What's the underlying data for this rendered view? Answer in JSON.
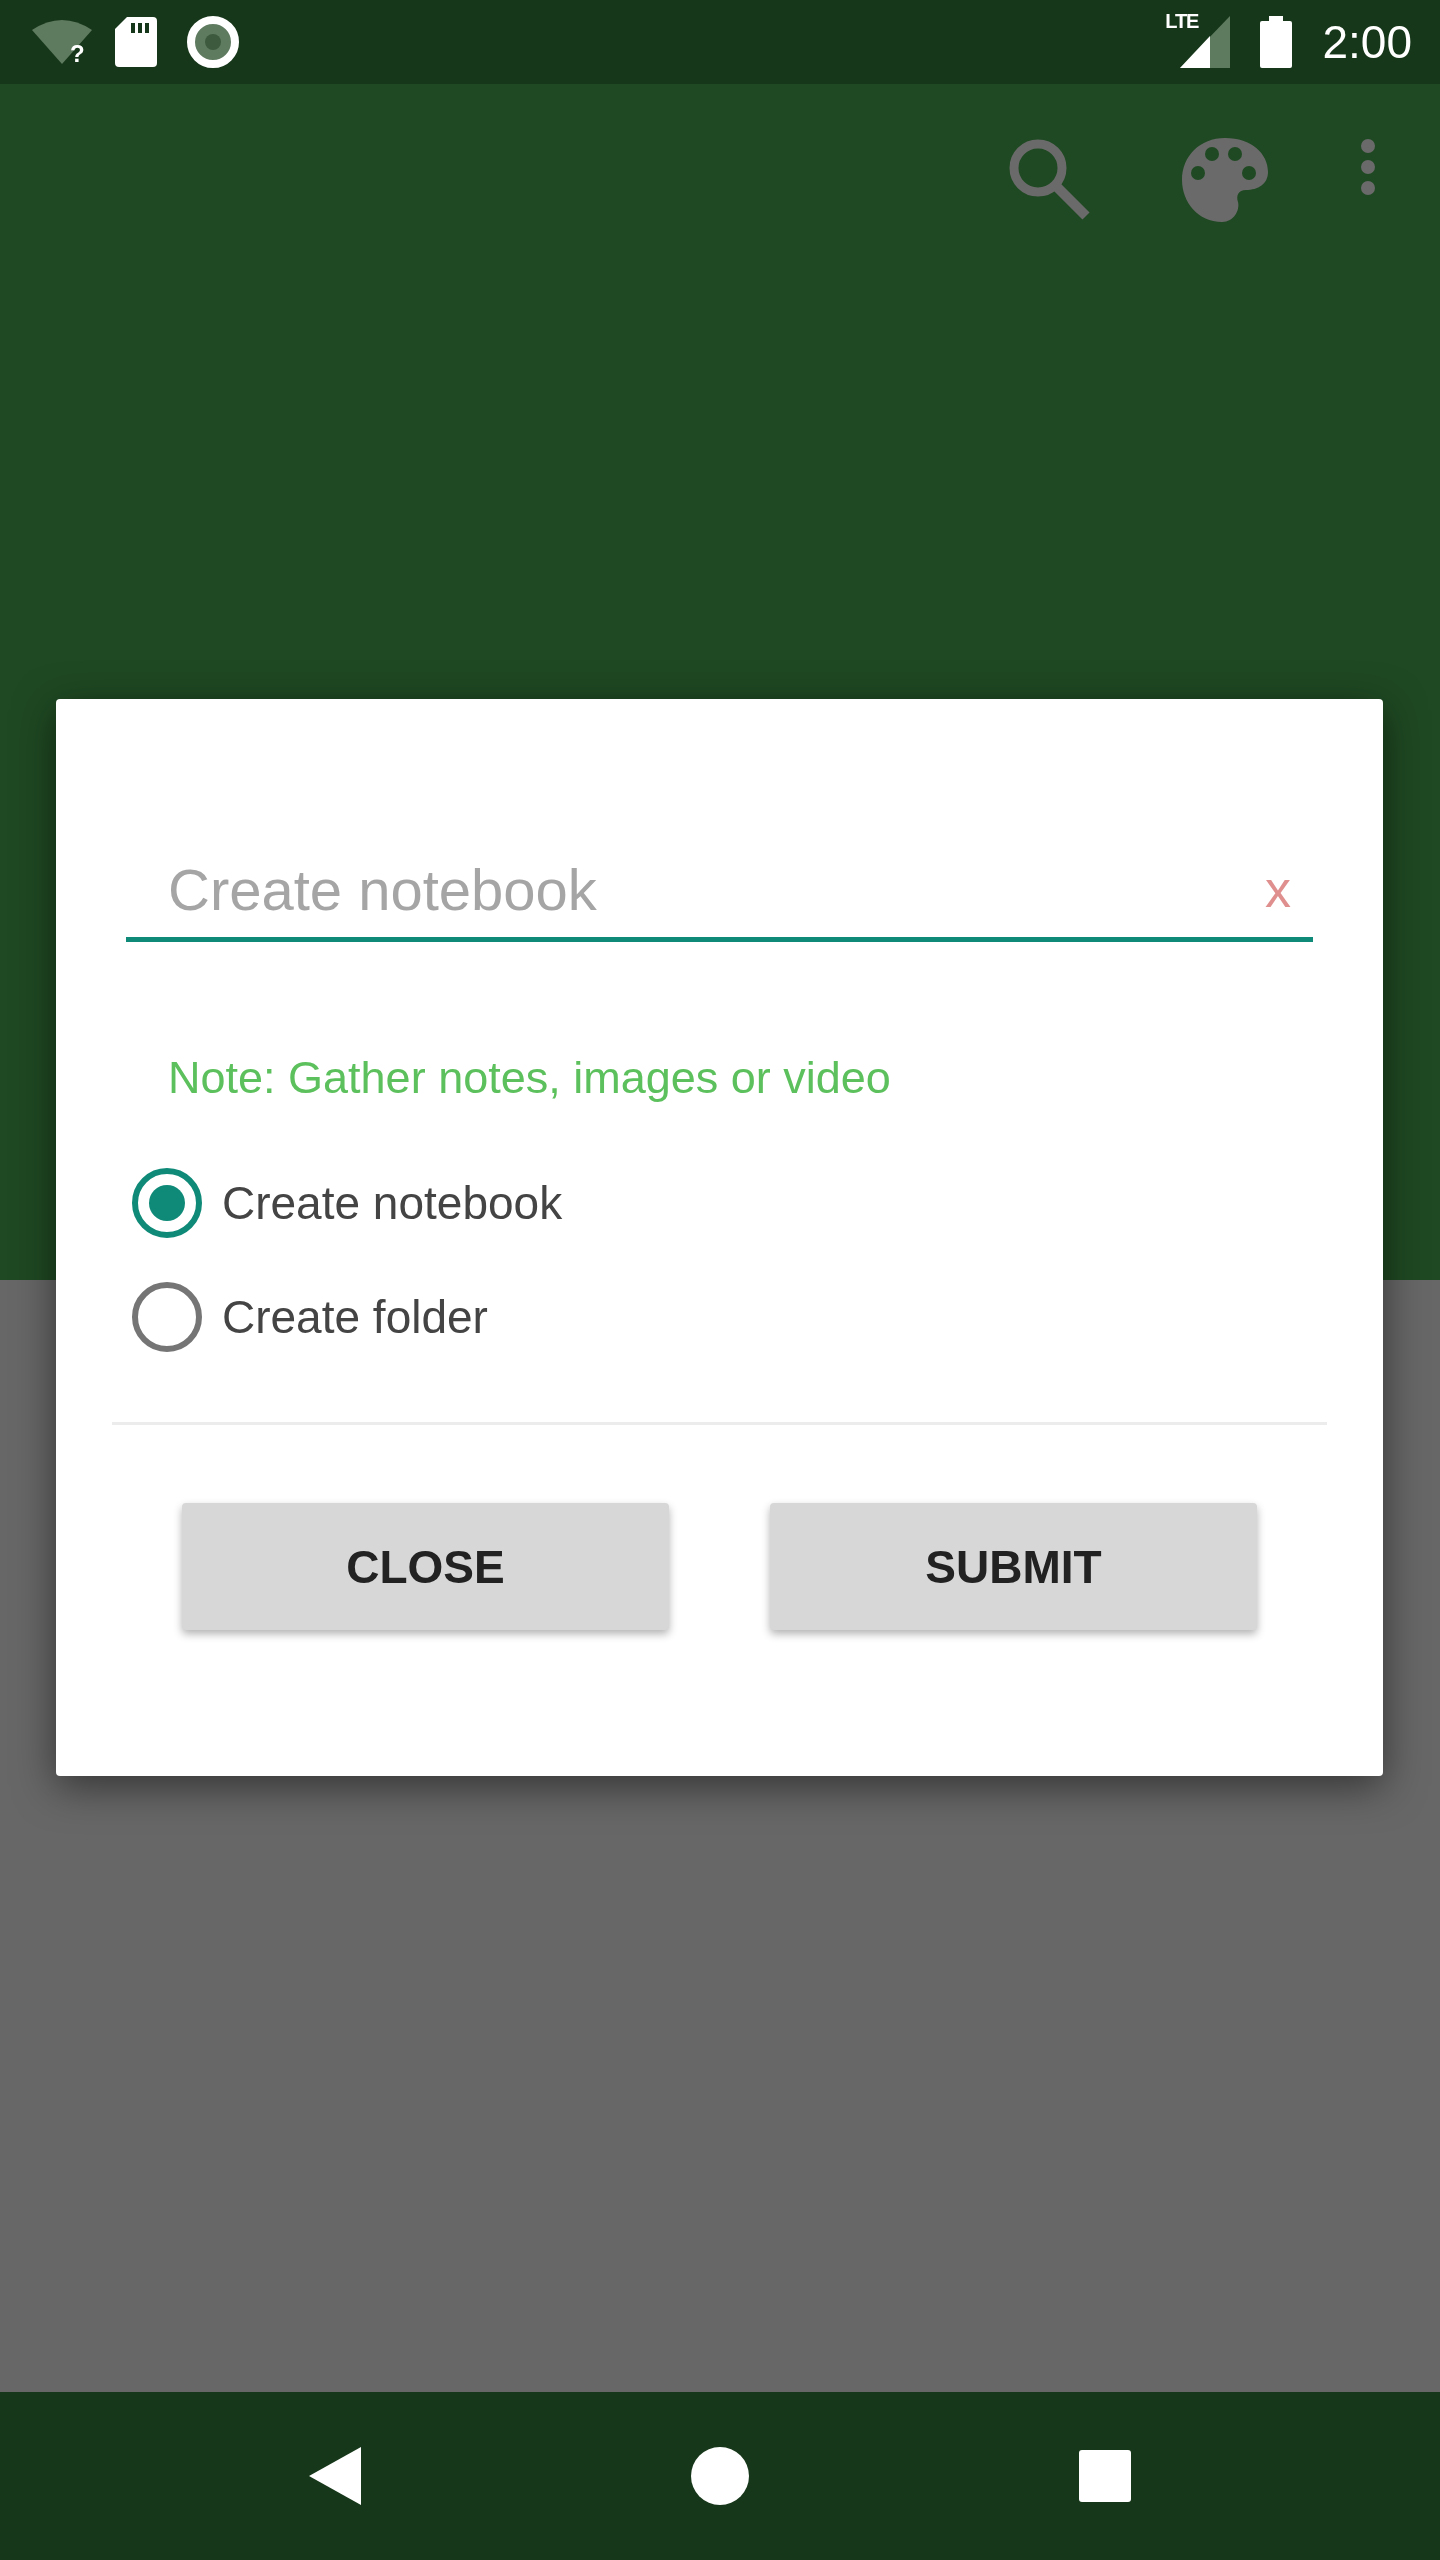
{
  "status_bar": {
    "wifi_badge": "?",
    "network": "LTE",
    "time": "2:00"
  },
  "dialog": {
    "input": {
      "placeholder": "Create notebook",
      "clear": "x"
    },
    "note": "Note: Gather notes, images or video",
    "options": [
      {
        "label": "Create notebook",
        "selected": true
      },
      {
        "label": "Create folder",
        "selected": false
      }
    ],
    "buttons": [
      "CLOSE",
      "SUBMIT"
    ]
  }
}
